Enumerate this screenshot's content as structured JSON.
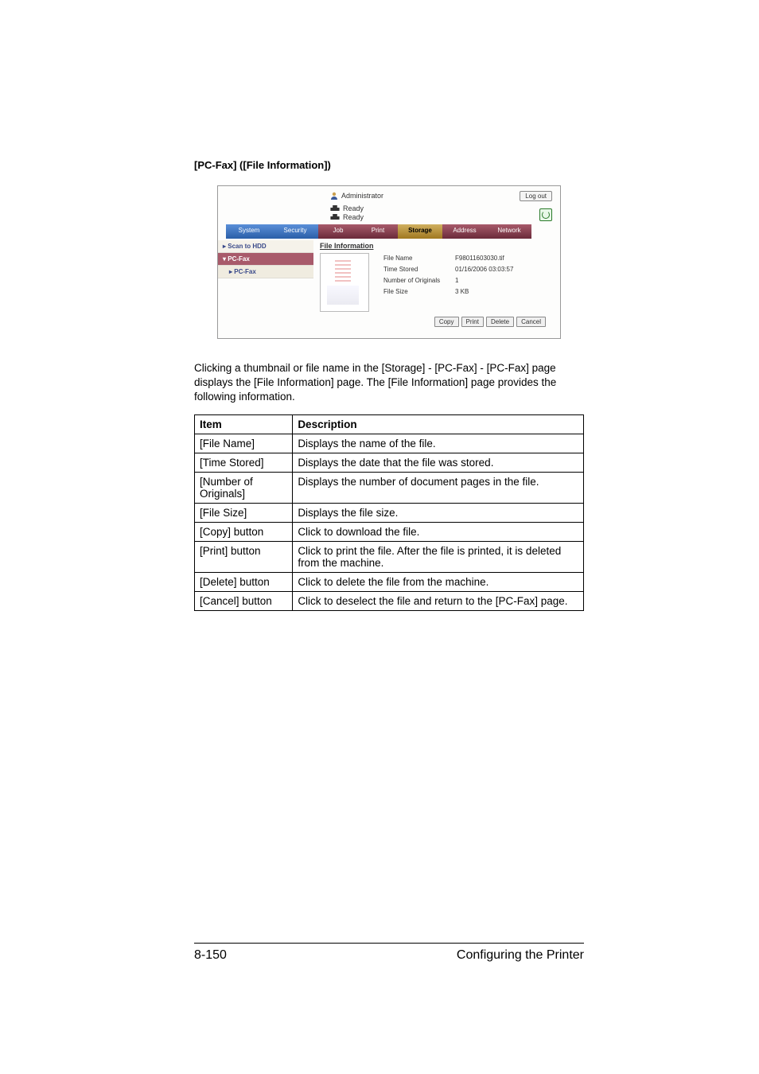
{
  "heading": "[PC-Fax] ([File Information])",
  "screenshot": {
    "admin_label": "Administrator",
    "logout": "Log out",
    "status1": "Ready",
    "status2": "Ready",
    "tabs": {
      "system": "System",
      "security": "Security",
      "job": "Job",
      "print": "Print",
      "storage": "Storage",
      "address": "Address",
      "network": "Network"
    },
    "sidebar": {
      "scan": "▸ Scan to HDD",
      "pcfax1": "▾ PC-Fax",
      "pcfax2": "▸ PC-Fax"
    },
    "content_title": "File Information",
    "meta": {
      "fname_l": "File Name",
      "fname_v": "F98011603030.tif",
      "time_l": "Time Stored",
      "time_v": "01/16/2006 03:03:57",
      "num_l": "Number of Originals",
      "num_v": "1",
      "size_l": "File Size",
      "size_v": "3 KB"
    },
    "buttons": {
      "copy": "Copy",
      "print": "Print",
      "delete": "Delete",
      "cancel": "Cancel"
    }
  },
  "paragraph": "Clicking a thumbnail or file name in the [Storage] - [PC-Fax] - [PC-Fax] page displays the [File Information] page. The [File Information] page provides the following information.",
  "table": {
    "h1": "Item",
    "h2": "Description",
    "rows": [
      {
        "item": "[File Name]",
        "desc": "Displays the name of the file."
      },
      {
        "item": "[Time Stored]",
        "desc": "Displays the date that the file was stored."
      },
      {
        "item": "[Number of Originals]",
        "desc": "Displays the number of document pages in the file."
      },
      {
        "item": "[File Size]",
        "desc": "Displays the file size."
      },
      {
        "item": "[Copy] button",
        "desc": "Click to download the file."
      },
      {
        "item": "[Print] button",
        "desc": "Click to print the file. After the file is printed, it is deleted from the machine."
      },
      {
        "item": "[Delete] button",
        "desc": "Click to delete the file from the machine."
      },
      {
        "item": "[Cancel] button",
        "desc": "Click to deselect the file and return to the [PC-Fax] page."
      }
    ]
  },
  "footer": {
    "page": "8-150",
    "section": "Configuring the Printer"
  }
}
